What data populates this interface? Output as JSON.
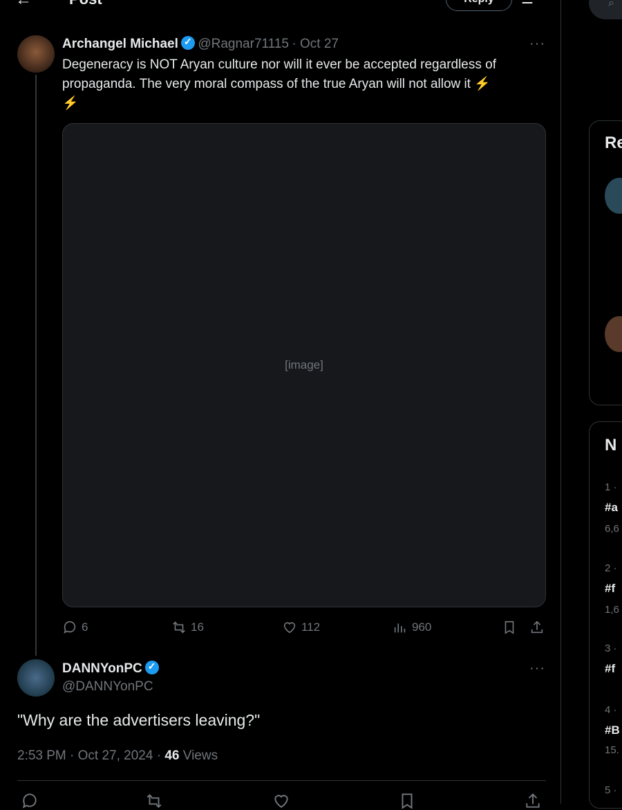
{
  "header": {
    "back": "←",
    "title": "Post",
    "reply_button": "Reply"
  },
  "tweet": {
    "author": "Archangel Michael",
    "handle": "@Ragnar71115",
    "date": "· Oct 27",
    "text_line1": "Degeneracy is NOT Aryan culture nor will it ever be accepted regardless of",
    "text_line2": "propaganda. The very moral compass of the true Aryan will not allow it ⚡",
    "text_line3": "⚡",
    "media_placeholder": "[image]",
    "stats": {
      "replies": "6",
      "reposts": "16",
      "likes": "112",
      "views": "960"
    }
  },
  "reply": {
    "author": "DANNYonPC",
    "handle": "@DANNYonPC",
    "text": "\"Why are the advertisers leaving?\"",
    "time": "2:53 PM · Oct 27, 2024 · ",
    "views_count": "46",
    "views_label": " Views"
  },
  "sidebar": {
    "card1_title": "Re",
    "card2_title": "N",
    "trends": [
      {
        "num": "1 ·",
        "tag": "#a",
        "count": "6,6"
      },
      {
        "num": "2 ·",
        "tag": "#f",
        "count": "1,6"
      },
      {
        "num": "3 ·",
        "tag": "#f",
        "count": ""
      },
      {
        "num": "4 ·",
        "tag": "#B",
        "count": "15."
      },
      {
        "num": "5 ·",
        "tag": "",
        "count": ""
      }
    ]
  },
  "icons": [
    "back-arrow-icon",
    "verified-icon",
    "more-icon",
    "reply-icon",
    "repost-icon",
    "like-icon",
    "views-icon",
    "bookmark-icon",
    "share-icon",
    "search-icon"
  ]
}
